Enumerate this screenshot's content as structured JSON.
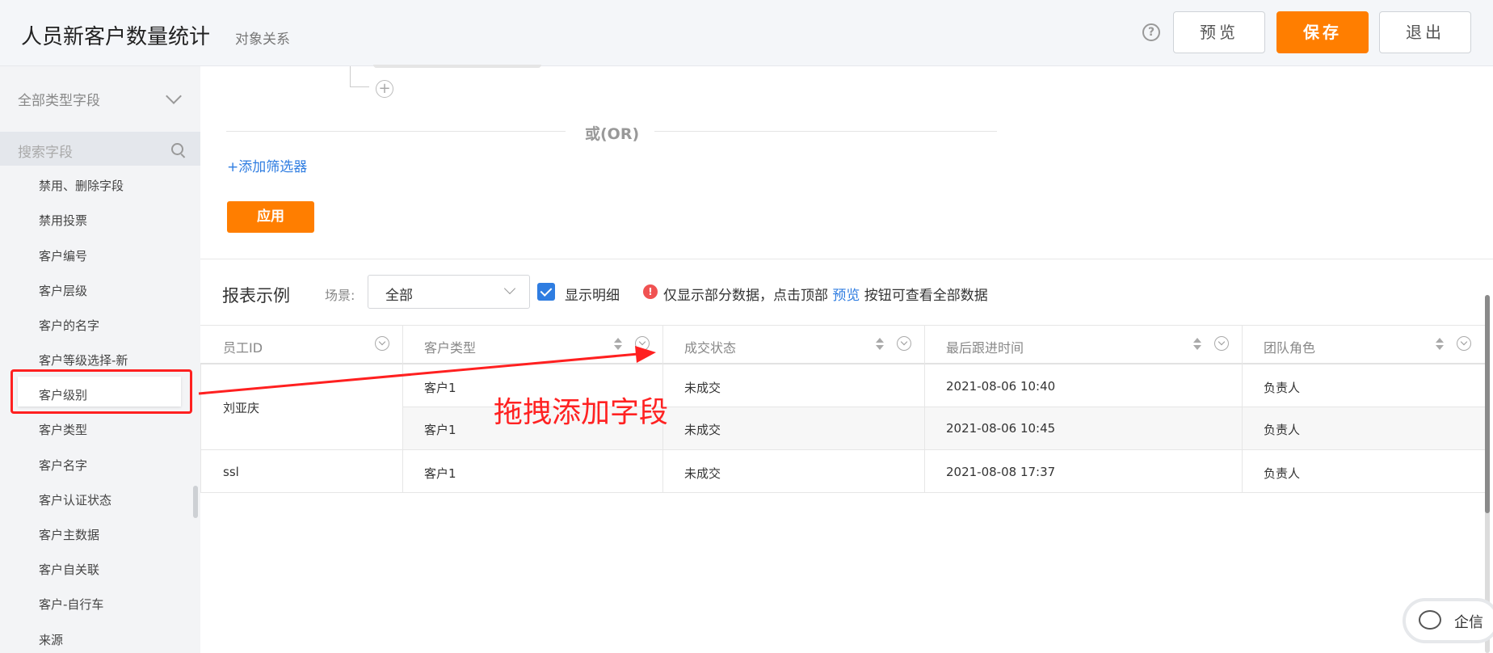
{
  "header": {
    "title": "人员新客户数量统计",
    "subtitle": "对象关系",
    "help_glyph": "?",
    "preview_label": "预览",
    "save_label": "保存",
    "exit_label": "退出"
  },
  "sidebar": {
    "type_select": "全部类型字段",
    "search_placeholder": "搜索字段",
    "fields": [
      "禁用、删除字段",
      "禁用投票",
      "客户编号",
      "客户层级",
      "客户的名字",
      "客户等级选择-新",
      "客户级别",
      "客户类型",
      "客户名字",
      "客户认证状态",
      "客户主数据",
      "客户自关联",
      "客户-自行车",
      "来源"
    ],
    "highlighted_field": "客户级别"
  },
  "filter": {
    "add_condition_glyph": "+",
    "or_text": "或(OR)",
    "add_filter": "+添加筛选器",
    "apply": "应用"
  },
  "report": {
    "title": "报表示例",
    "scene_label": "场景:",
    "scene_value": "全部",
    "show_detail": "显示明细",
    "show_detail_checked": true,
    "warn_glyph": "!",
    "notice_prefix": "仅显示部分数据，点击顶部 ",
    "notice_link": "预览",
    "notice_suffix": " 按钮可查看全部数据"
  },
  "table": {
    "columns": [
      "员工ID",
      "客户类型",
      "成交状态",
      "最后跟进时间",
      "团队角色"
    ],
    "groups": [
      {
        "employee": "刘亚庆",
        "rows": [
          [
            "客户1",
            "未成交",
            "2021-08-06 10:40",
            "负责人"
          ],
          [
            "客户1",
            "未成交",
            "2021-08-06 10:45",
            "负责人"
          ]
        ]
      },
      {
        "employee": "ssl",
        "rows": [
          [
            "客户1",
            "未成交",
            "2021-08-08 17:37",
            "负责人"
          ]
        ]
      }
    ]
  },
  "annotation": {
    "text": "拖拽添加字段",
    "color": "#ff2020"
  },
  "chat": {
    "label": "企信"
  },
  "colors": {
    "accent": "#ff7e00",
    "link": "#2f7de1"
  }
}
